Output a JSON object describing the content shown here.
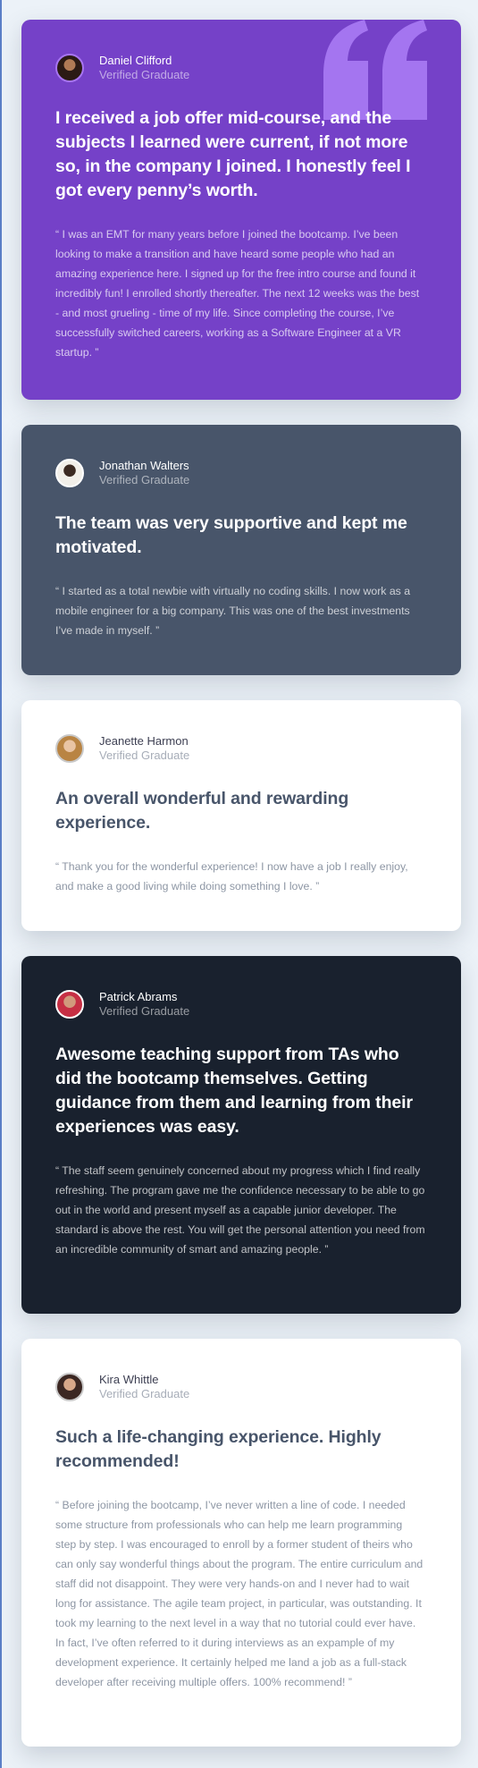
{
  "colors": {
    "purple": "#7541c8",
    "slate": "#48556a",
    "white": "#ffffff",
    "dark": "#19212e",
    "background": "#ecf2f8"
  },
  "testimonials": [
    {
      "name": "Daniel Clifford",
      "role": "Verified Graduate",
      "headline": "I received a job offer mid-course, and the subjects I learned were current, if not more so, in the company I joined. I honestly feel I got every penny’s worth.",
      "body": "“ I was an EMT for many years before I joined the bootcamp. I’ve been looking to make a transition and have heard some people who had an amazing experience here. I signed up for the free intro course and found it incredibly fun! I enrolled shortly thereafter. The next 12 weeks was the best - and most grueling - time of my life. Since completing the course, I’ve successfully switched careers, working as a Software Engineer at a VR startup. ”",
      "decoration": "quotation-mark-icon"
    },
    {
      "name": "Jonathan Walters",
      "role": "Verified Graduate",
      "headline": "The team was very supportive and kept me motivated.",
      "body": "“ I started as a total newbie with virtually no coding skills. I now work as a mobile engineer for a big company. This was one of the best investments I’ve made in myself. ”"
    },
    {
      "name": "Jeanette Harmon",
      "role": "Verified Graduate",
      "headline": "An overall wonderful and rewarding experience.",
      "body": "“ Thank you for the wonderful experience! I now have a job I really enjoy, and make a good living while doing something I love. ”"
    },
    {
      "name": "Patrick Abrams",
      "role": "Verified Graduate",
      "headline": "Awesome teaching support from TAs who did the bootcamp themselves. Getting guidance from them and learning from their experiences was easy.",
      "body": "“ The staff seem genuinely concerned about my progress which I find really refreshing. The program gave me the confidence necessary to be able to go out in the world and present myself as a capable junior developer. The standard is above the rest. You will get the personal attention you need from an incredible community of smart and amazing people. ”"
    },
    {
      "name": "Kira Whittle",
      "role": "Verified Graduate",
      "headline": "Such a life-changing experience. Highly recommended!",
      "body": "“ Before joining the bootcamp, I’ve never written a line of code. I needed some structure from professionals who can help me learn programming step by step. I was encouraged to enroll by a former student of theirs who can only say wonderful things about the program. The entire curriculum and staff did not disappoint. They were very hands-on and I never had to wait long for assistance. The agile team project, in particular, was outstanding. It took my learning to the next level in a way that no tutorial could ever have. In fact, I’ve often referred to it during interviews as an expample of my development experience. It certainly helped me land a job as a full-stack developer after receiving multiple offers. 100% recommend! ”"
    }
  ]
}
